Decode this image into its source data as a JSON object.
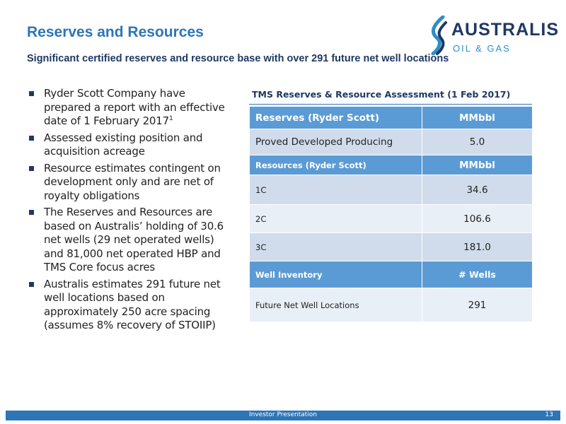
{
  "header": {
    "title": "Reserves and Resources",
    "subtitle": "Significant certified reserves and resource base with over 291 future net well locations"
  },
  "logo": {
    "name": "AUSTRALIS",
    "tagline": "OIL & GAS",
    "colors": {
      "dark": "#1f3864",
      "accent": "#2b8fc9"
    }
  },
  "bullets": [
    {
      "text": "Ryder Scott Company have prepared a report with an effective date of 1 February 2017",
      "sup": "1"
    },
    {
      "text": "Assessed existing position and acquisition acreage"
    },
    {
      "text": "Resource estimates contingent on development only and are net of royalty obligations"
    },
    {
      "text": "The Reserves and Resources are based on Australis’ holding of 30.6 net wells (29 net operated wells) and 81,000 net operated HBP and TMS Core focus acres"
    },
    {
      "text": "Australis estimates 291 future net well locations based on approximately 250 acre spacing (assumes 8% recovery of STOIIP)"
    }
  ],
  "table": {
    "caption": "TMS Reserves & Resource Assessment (1 Feb 2017)",
    "sections": [
      {
        "header": {
          "label": "Reserves (Ryder Scott)",
          "unit": "MMbbl"
        },
        "rows": [
          {
            "label": "Proved Developed Producing",
            "value": "5.0"
          }
        ]
      },
      {
        "header": {
          "label": "Resources (Ryder Scott)",
          "unit": "MMbbl"
        },
        "rows": [
          {
            "label": "1C",
            "value": "34.6"
          },
          {
            "label": "2C",
            "value": "106.6"
          },
          {
            "label": "3C",
            "value": "181.0"
          }
        ]
      },
      {
        "header": {
          "label": "Well Inventory",
          "unit": "# Wells"
        },
        "rows": [
          {
            "label": "Future Net Well Locations",
            "value": "291"
          }
        ]
      }
    ]
  },
  "footer": {
    "text": "Investor Presentation",
    "page": "13"
  },
  "colors": {
    "title": "#2e75b6",
    "subtitle": "#1f3864",
    "table_header": "#5b9bd5",
    "row_dark": "#d0dceb",
    "row_light": "#e9eff7",
    "footer": "#2e75b6"
  }
}
